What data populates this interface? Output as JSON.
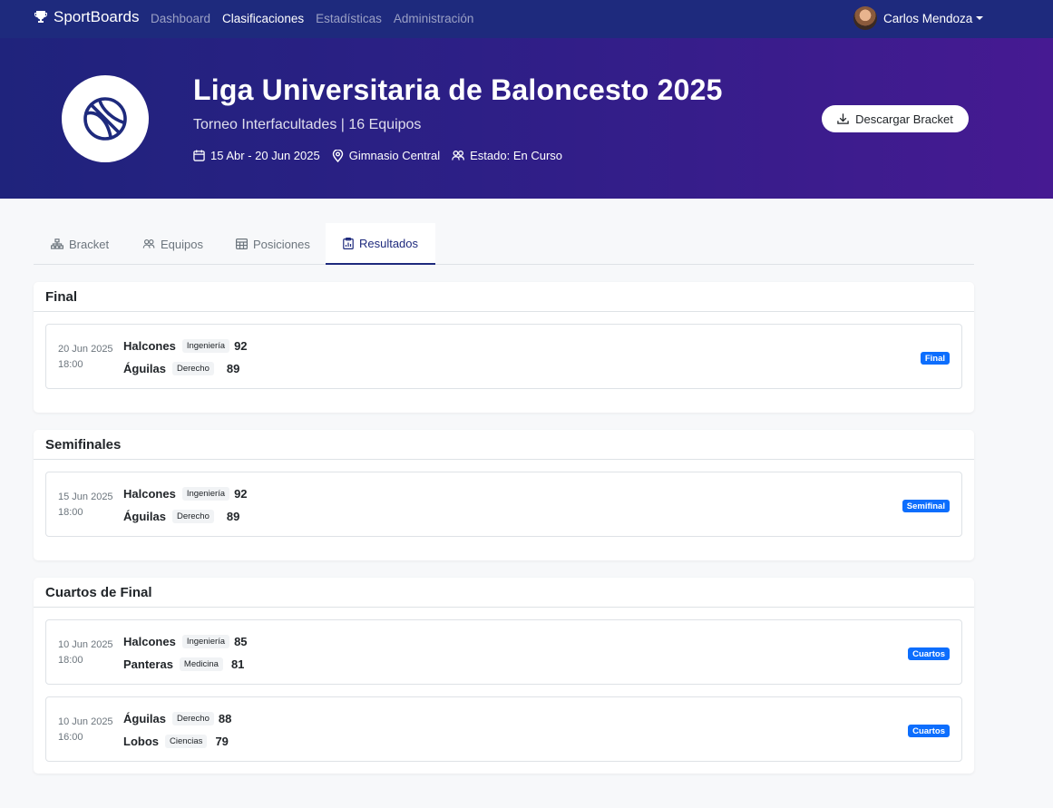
{
  "navbar": {
    "brand": "SportBoards",
    "links": [
      {
        "label": "Dashboard"
      },
      {
        "label": "Clasificaciones"
      },
      {
        "label": "Estadísticas"
      },
      {
        "label": "Administración"
      }
    ],
    "user_name": "Carlos Mendoza"
  },
  "hero": {
    "title": "Liga Universitaria de Baloncesto 2025",
    "subtitle": "Torneo Interfacultades | 16 Equipos",
    "dates": "15 Abr - 20 Jun 2025",
    "venue": "Gimnasio Central",
    "status": "Estado: En Curso",
    "download_label": "Descargar Bracket"
  },
  "tabs": [
    {
      "label": "Bracket",
      "icon": "diagram-icon"
    },
    {
      "label": "Equipos",
      "icon": "people-icon"
    },
    {
      "label": "Posiciones",
      "icon": "table-icon"
    },
    {
      "label": "Resultados",
      "icon": "clipboard-chart-icon"
    }
  ],
  "sections": [
    {
      "title": "Final",
      "matches": [
        {
          "date": "20 Jun 2025",
          "time": "18:00",
          "team1": {
            "name": "Halcones",
            "faculty": "Ingeniería",
            "score": "92"
          },
          "team2": {
            "name": "Águilas",
            "faculty": "Derecho",
            "score": "89"
          },
          "badge": "Final"
        }
      ]
    },
    {
      "title": "Semifinales",
      "matches": [
        {
          "date": "15 Jun 2025",
          "time": "18:00",
          "team1": {
            "name": "Halcones",
            "faculty": "Ingeniería",
            "score": "92"
          },
          "team2": {
            "name": "Águilas",
            "faculty": "Derecho",
            "score": "89"
          },
          "badge": "Semifinal"
        }
      ]
    },
    {
      "title": "Cuartos de Final",
      "matches": [
        {
          "date": "10 Jun 2025",
          "time": "18:00",
          "team1": {
            "name": "Halcones",
            "faculty": "Ingeniería",
            "score": "85"
          },
          "team2": {
            "name": "Panteras",
            "faculty": "Medicina",
            "score": "81"
          },
          "badge": "Cuartos"
        },
        {
          "date": "10 Jun 2025",
          "time": "16:00",
          "team1": {
            "name": "Águilas",
            "faculty": "Derecho",
            "score": "88"
          },
          "team2": {
            "name": "Lobos",
            "faculty": "Ciencias",
            "score": "79"
          },
          "badge": "Cuartos"
        }
      ]
    }
  ],
  "colors": {
    "navbar": "#1e2a7d",
    "hero_start": "#1f237c",
    "hero_end": "#461a92",
    "badge": "#0d6efd"
  }
}
